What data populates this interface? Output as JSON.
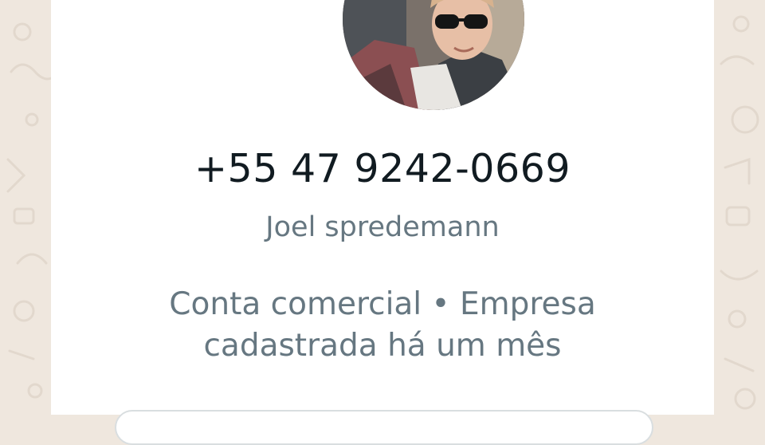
{
  "contact": {
    "phone": "+55 47 9242-0669",
    "name": "Joel spredemann",
    "business_line1": "Conta comercial • Empresa",
    "business_line2": "cadastrada há um mês"
  },
  "avatar": {
    "icon": "profile-photo"
  },
  "colors": {
    "background": "#efe7de",
    "card": "#ffffff",
    "primary_text": "#111b21",
    "secondary_text": "#667781"
  }
}
